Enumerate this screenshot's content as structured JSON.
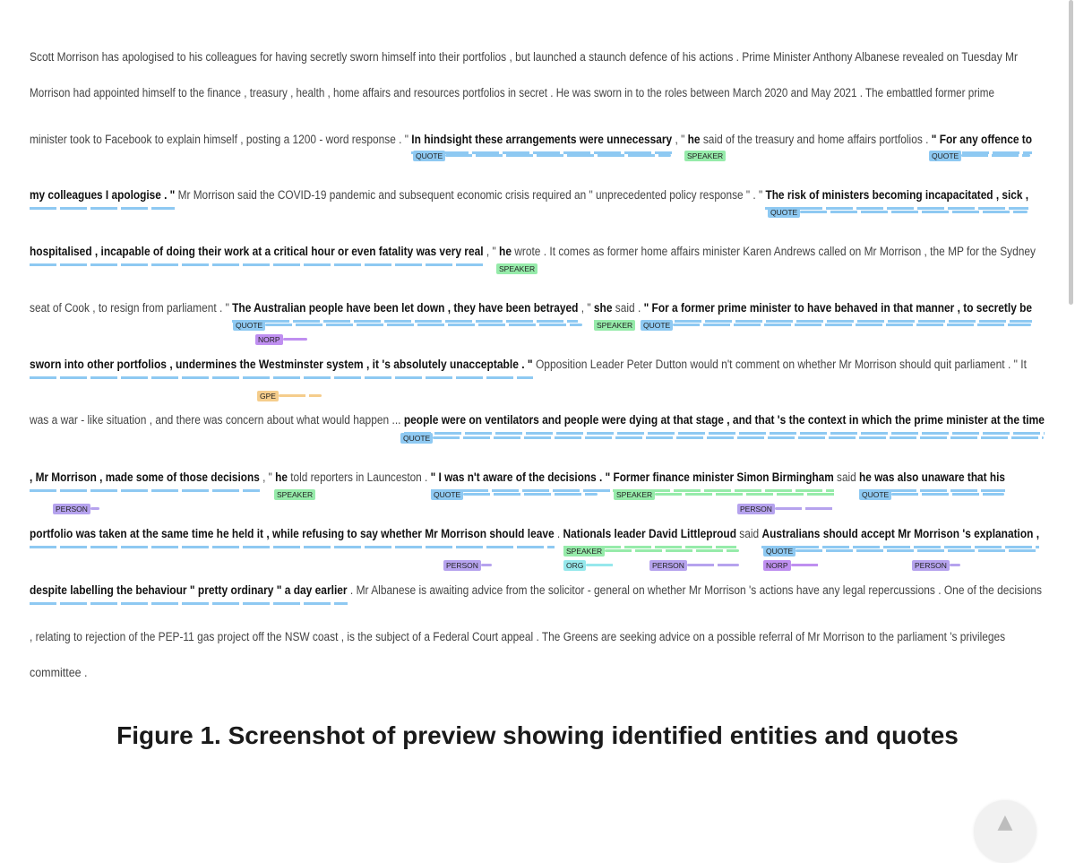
{
  "document": {
    "lines": [
      {
        "segments": [
          {
            "t": "Scott Morrison has apologised to his colleagues for having secretly sworn himself into their portfolios , but launched a staunch defence of his actions . Prime Minister Anthony Albanese revealed on Tuesday Mr",
            "b": false
          }
        ]
      },
      {
        "segments": [
          {
            "t": "Morrison had appointed himself to the finance , treasury , health , home affairs and resources portfolios in secret . He was sworn in to the roles between March 2020 and May 2021 . The embattled former prime",
            "b": false
          }
        ]
      },
      {
        "segments": [
          {
            "t": "minister took to Facebook to explain himself , posting a 1200 - word response . \" ",
            "b": false
          },
          {
            "t": "In hindsight these arrangements were unnecessary",
            "b": true
          },
          {
            "t": " , \" ",
            "b": false
          },
          {
            "t": "he",
            "b": true
          },
          {
            "t": " said of the treasury and home affairs portfolios . ",
            "b": false
          },
          {
            "t": "\" For any offence to",
            "b": true
          }
        ]
      },
      {
        "segments": [
          {
            "t": "my colleagues I apologise . \"",
            "b": true
          },
          {
            "t": " Mr Morrison said the COVID-19 pandemic and subsequent economic crisis required an \" unprecedented policy response \" . \" ",
            "b": false
          },
          {
            "t": "The risk of ministers becoming incapacitated , sick ,",
            "b": true
          }
        ]
      },
      {
        "segments": [
          {
            "t": "hospitalised , incapable of doing their work at a critical hour or even fatality was very real",
            "b": true
          },
          {
            "t": " , \" ",
            "b": false
          },
          {
            "t": "he",
            "b": true
          },
          {
            "t": " wrote . It comes as former home affairs minister Karen Andrews called on Mr Morrison , the MP for the Sydney",
            "b": false
          }
        ]
      },
      {
        "segments": [
          {
            "t": "seat of Cook , to resign from parliament . \" ",
            "b": false
          },
          {
            "t": "The Australian people have been let down , they have been betrayed",
            "b": true
          },
          {
            "t": " , \" ",
            "b": false
          },
          {
            "t": "she",
            "b": true
          },
          {
            "t": " said . ",
            "b": false
          },
          {
            "t": "\" For a former prime minister to have behaved in that manner , to secretly be",
            "b": true
          }
        ]
      },
      {
        "segments": [
          {
            "t": "sworn into other portfolios , undermines the Westminster system , it 's absolutely unacceptable . \"",
            "b": true
          },
          {
            "t": " Opposition Leader Peter Dutton would n't comment on whether Mr Morrison should quit parliament . \" It",
            "b": false
          }
        ]
      },
      {
        "segments": [
          {
            "t": "was a war - like situation , and there was concern about what would happen ... ",
            "b": false
          },
          {
            "t": "people were on ventilators and people were dying at that stage , and that 's the context in which the prime minister at the time",
            "b": true
          }
        ]
      },
      {
        "segments": [
          {
            "t": ", Mr Morrison , made some of those decisions",
            "b": true
          },
          {
            "t": " , \" ",
            "b": false
          },
          {
            "t": "he",
            "b": true
          },
          {
            "t": " told reporters in Launceston . ",
            "b": false
          },
          {
            "t": "\" I was n't aware of the decisions . \"",
            "b": true
          },
          {
            "t": " ",
            "b": false
          },
          {
            "t": "Former finance minister Simon Birmingham",
            "b": true
          },
          {
            "t": " said ",
            "b": false
          },
          {
            "t": "he was also unaware that his",
            "b": true
          }
        ]
      },
      {
        "segments": [
          {
            "t": "portfolio was taken at the same time he held it , while refusing to say whether Mr Morrison should leave",
            "b": true
          },
          {
            "t": " . ",
            "b": false
          },
          {
            "t": "Nationals leader David Littleproud",
            "b": true
          },
          {
            "t": " said ",
            "b": false
          },
          {
            "t": "Australians should accept Mr Morrison 's explanation ,",
            "b": true
          }
        ]
      },
      {
        "segments": [
          {
            "t": "despite labelling the behaviour \" pretty ordinary \" a day earlier",
            "b": true
          },
          {
            "t": " . Mr Albanese is awaiting advice from the solicitor - general on whether Mr Morrison 's actions have any legal repercussions . One of the decisions",
            "b": false
          }
        ]
      },
      {
        "segments": [
          {
            "t": ", relating to rejection of the PEP-11 gas project off the NSW coast , is the subject of a Federal Court appeal . The Greens are seeking advice on a possible referral of Mr Morrison to the parliament 's privileges",
            "b": false
          }
        ]
      },
      {
        "segments": [
          {
            "t": "committee .",
            "b": false
          }
        ]
      }
    ]
  },
  "entity_colors": {
    "QUOTE": "#8ec9f2",
    "SPEAKER": "#96ebaa",
    "PERSON": "#b6a3ee",
    "NORP": "#bf8ff0",
    "GPE": "#f5cd8c",
    "ORG": "#96e8ec"
  },
  "annotations": [
    {
      "label": "QUOTE",
      "kind": "QUOTE"
    },
    {
      "label": "SPEAKER",
      "kind": "SPEAKER"
    },
    {
      "label": "QUOTE",
      "kind": "QUOTE"
    },
    {
      "label": "QUOTE",
      "kind": "QUOTE"
    },
    {
      "label": "SPEAKER",
      "kind": "SPEAKER"
    },
    {
      "label": "QUOTE",
      "kind": "QUOTE"
    },
    {
      "label": "NORP",
      "kind": "NORP"
    },
    {
      "label": "SPEAKER",
      "kind": "SPEAKER"
    },
    {
      "label": "QUOTE",
      "kind": "QUOTE"
    },
    {
      "label": "GPE",
      "kind": "GPE"
    },
    {
      "label": "QUOTE",
      "kind": "QUOTE"
    },
    {
      "label": "SPEAKER",
      "kind": "SPEAKER"
    },
    {
      "label": "QUOTE",
      "kind": "QUOTE"
    },
    {
      "label": "SPEAKER",
      "kind": "SPEAKER"
    },
    {
      "label": "QUOTE",
      "kind": "QUOTE"
    },
    {
      "label": "PERSON",
      "kind": "PERSON"
    },
    {
      "label": "PERSON",
      "kind": "PERSON"
    },
    {
      "label": "SPEAKER",
      "kind": "SPEAKER"
    },
    {
      "label": "QUOTE",
      "kind": "QUOTE"
    },
    {
      "label": "PERSON",
      "kind": "PERSON"
    },
    {
      "label": "ORG",
      "kind": "ORG"
    },
    {
      "label": "PERSON",
      "kind": "PERSON"
    },
    {
      "label": "NORP",
      "kind": "NORP"
    },
    {
      "label": "PERSON",
      "kind": "PERSON"
    }
  ],
  "caption": "Figure 1. Screenshot of preview showing identified entities and quotes",
  "scroll_top_icon": "arrow-up-icon"
}
